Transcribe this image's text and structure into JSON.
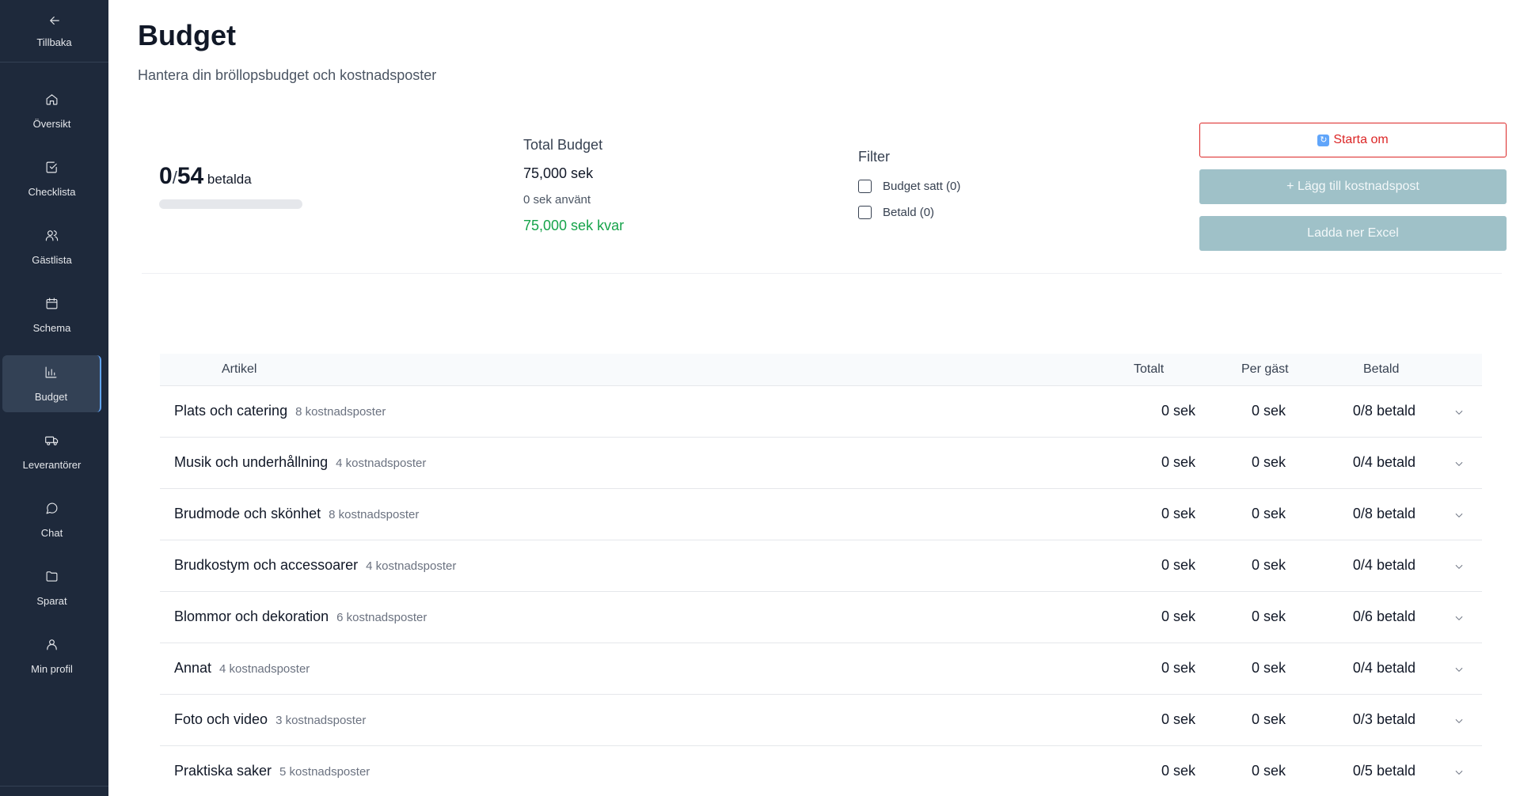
{
  "sidebar": {
    "back_label": "Tillbaka",
    "items": [
      {
        "label": "Översikt",
        "icon": "home-icon"
      },
      {
        "label": "Checklista",
        "icon": "check-square-icon"
      },
      {
        "label": "Gästlista",
        "icon": "users-icon"
      },
      {
        "label": "Schema",
        "icon": "calendar-icon"
      },
      {
        "label": "Budget",
        "icon": "bar-chart-icon",
        "active": true
      },
      {
        "label": "Leverantörer",
        "icon": "truck-icon"
      },
      {
        "label": "Chat",
        "icon": "chat-icon"
      },
      {
        "label": "Sparat",
        "icon": "folder-icon"
      },
      {
        "label": "Min profil",
        "icon": "user-icon"
      }
    ]
  },
  "header": {
    "title": "Budget",
    "subtitle": "Hantera din bröllopsbudget och kostnadsposter"
  },
  "progress": {
    "paid": "0",
    "slash": "/",
    "total": "54",
    "label": "betalda",
    "fraction": 0
  },
  "budget": {
    "heading": "Total Budget",
    "total": "75,000 sek",
    "used": "0 sek använt",
    "remaining": "75,000 sek kvar"
  },
  "filter": {
    "heading": "Filter",
    "options": [
      {
        "label": "Budget satt (0)",
        "checked": false
      },
      {
        "label": "Betald (0)",
        "checked": false
      }
    ]
  },
  "actions": {
    "restart": "Starta om",
    "add": "+ Lägg till kostnadspost",
    "excel": "Ladda ner Excel"
  },
  "table": {
    "headers": {
      "article": "Artikel",
      "total": "Totalt",
      "per_guest": "Per gäst",
      "paid": "Betald"
    },
    "rows": [
      {
        "name": "Plats och catering",
        "count": "8 kostnadsposter",
        "total": "0 sek",
        "per_guest": "0 sek",
        "paid": "0/8 betald"
      },
      {
        "name": "Musik och underhållning",
        "count": "4 kostnadsposter",
        "total": "0 sek",
        "per_guest": "0 sek",
        "paid": "0/4 betald"
      },
      {
        "name": "Brudmode och skönhet",
        "count": "8 kostnadsposter",
        "total": "0 sek",
        "per_guest": "0 sek",
        "paid": "0/8 betald"
      },
      {
        "name": "Brudkostym och accessoarer",
        "count": "4 kostnadsposter",
        "total": "0 sek",
        "per_guest": "0 sek",
        "paid": "0/4 betald"
      },
      {
        "name": "Blommor och dekoration",
        "count": "6 kostnadsposter",
        "total": "0 sek",
        "per_guest": "0 sek",
        "paid": "0/6 betald"
      },
      {
        "name": "Annat",
        "count": "4 kostnadsposter",
        "total": "0 sek",
        "per_guest": "0 sek",
        "paid": "0/4 betald"
      },
      {
        "name": "Foto och video",
        "count": "3 kostnadsposter",
        "total": "0 sek",
        "per_guest": "0 sek",
        "paid": "0/3 betald"
      },
      {
        "name": "Praktiska saker",
        "count": "5 kostnadsposter",
        "total": "0 sek",
        "per_guest": "0 sek",
        "paid": "0/5 betald"
      }
    ]
  },
  "colors": {
    "sidebar_bg": "#1e293b",
    "accent_green": "#16a34a",
    "restart_red": "#dc2626",
    "disabled_button": "#9fc1c8"
  }
}
